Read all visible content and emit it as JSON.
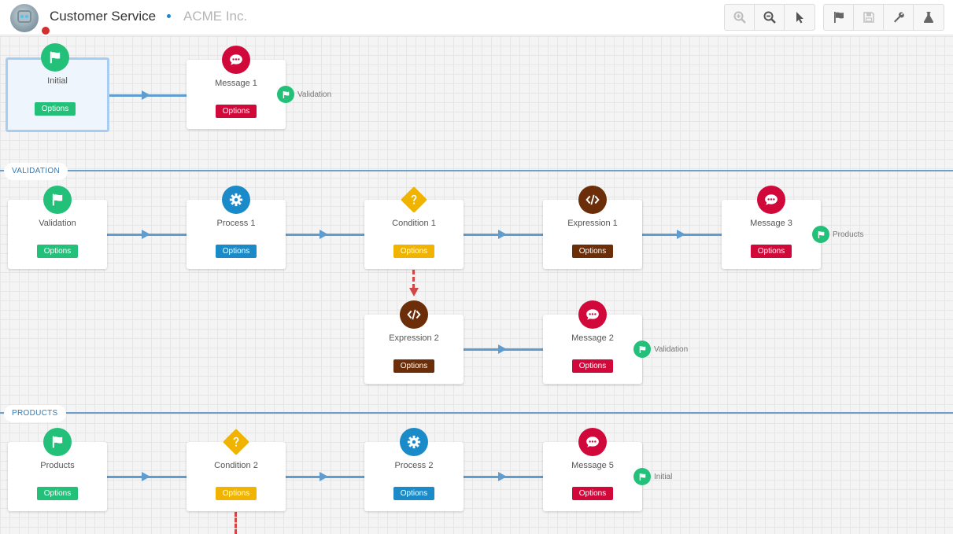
{
  "header": {
    "title": "Customer Service",
    "company": "ACME Inc.",
    "tools_left": [
      "zoom-in-icon",
      "zoom-out-icon",
      "pointer-icon"
    ],
    "tools_right": [
      "flag-icon",
      "save-icon",
      "wrench-icon",
      "flask-icon"
    ]
  },
  "colors": {
    "start": "#23c07a",
    "message": "#d1093a",
    "process": "#1a8ac8",
    "condition": "#f0b400",
    "expression": "#6b2e08",
    "flow": "#5f9ccf",
    "branch": "#d14646",
    "lane": "#2e7ab8"
  },
  "lanes": [
    {
      "label": "VALIDATION"
    },
    {
      "label": "PRODUCTS"
    }
  ],
  "nodes": [
    {
      "name": "Initial",
      "type": "start",
      "options": "Options"
    },
    {
      "name": "Message 1",
      "type": "message",
      "options": "Options"
    },
    {
      "name": "Validation",
      "type": "start",
      "options": "Options"
    },
    {
      "name": "Process 1",
      "type": "process",
      "options": "Options"
    },
    {
      "name": "Condition 1",
      "type": "condition",
      "options": "Options"
    },
    {
      "name": "Expression 1",
      "type": "expression",
      "options": "Options"
    },
    {
      "name": "Message 3",
      "type": "message",
      "options": "Options"
    },
    {
      "name": "Expression 2",
      "type": "expression",
      "options": "Options"
    },
    {
      "name": "Message 2",
      "type": "message",
      "options": "Options"
    },
    {
      "name": "Products",
      "type": "start",
      "options": "Options"
    },
    {
      "name": "Condition 2",
      "type": "condition",
      "options": "Options"
    },
    {
      "name": "Process 2",
      "type": "process",
      "options": "Options"
    },
    {
      "name": "Message 5",
      "type": "message",
      "options": "Options"
    }
  ],
  "gotos": [
    {
      "target": "Validation"
    },
    {
      "target": "Products"
    },
    {
      "target": "Validation"
    },
    {
      "target": "Initial"
    }
  ]
}
